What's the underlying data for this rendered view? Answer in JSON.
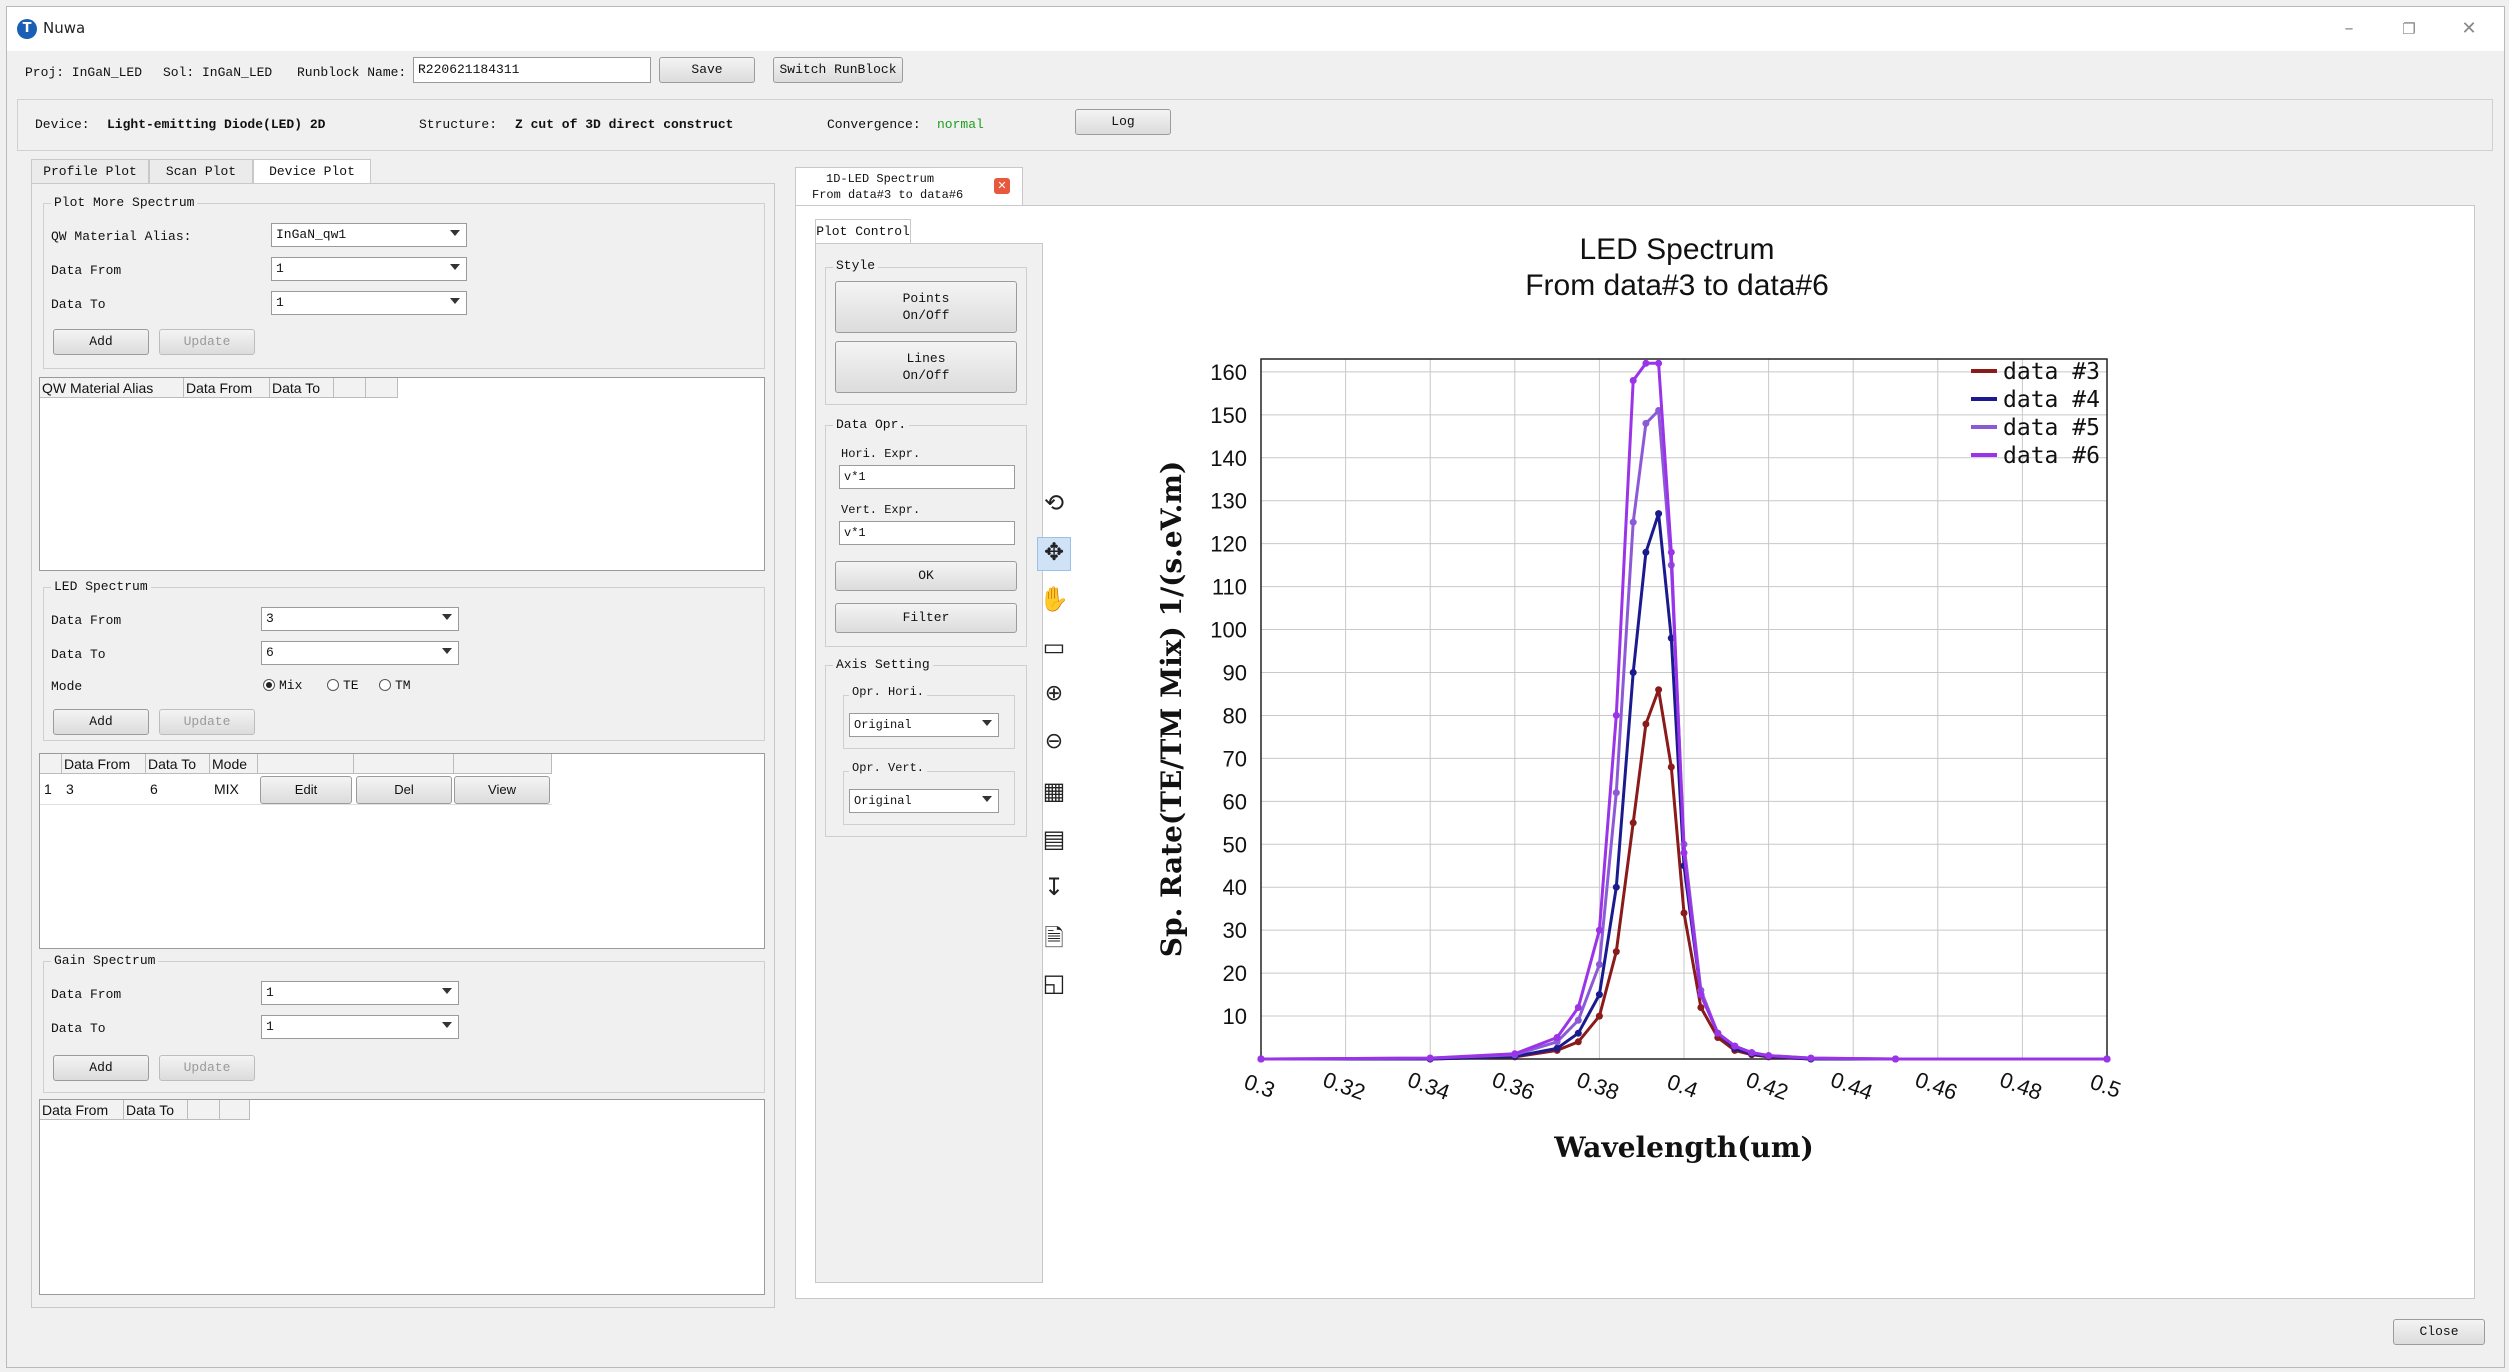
{
  "app": {
    "title": "Nuwa"
  },
  "toolbar": {
    "proj": "Proj: InGaN_LED",
    "sol": "Sol: InGaN_LED",
    "runblock_label": "Runblock Name:",
    "runblock_value": "R220621184311",
    "save_label": "Save",
    "switch_label": "Switch RunBlock"
  },
  "device_bar": {
    "device_label": "Device:",
    "device_value": "Light-emitting Diode(LED) 2D",
    "structure_label": "Structure:",
    "structure_value": "Z cut of 3D direct construct",
    "convergence_label": "Convergence:",
    "convergence_value": "normal",
    "log_label": "Log"
  },
  "colors": {
    "convergence": "#1f9e1f",
    "accent": "#cfe2f6",
    "close_tab": "#e8583c"
  },
  "left_tabs": [
    "Profile Plot",
    "Scan Plot",
    "Device Plot"
  ],
  "more_spectrum": {
    "title": "Plot More Spectrum",
    "alias_label": "QW Material Alias:",
    "alias_value": "InGaN_qw1",
    "from_label": "Data From",
    "from_value": "1",
    "to_label": "Data To",
    "to_value": "1",
    "add": "Add",
    "update": "Update",
    "columns": [
      "QW Material Alias",
      "Data From",
      "Data To",
      "",
      ""
    ]
  },
  "led_spectrum": {
    "title": "LED Spectrum",
    "from_label": "Data From",
    "from_value": "3",
    "to_label": "Data To",
    "to_value": "6",
    "mode_label": "Mode",
    "modes": [
      "Mix",
      "TE",
      "TM"
    ],
    "add": "Add",
    "update": "Update",
    "columns": [
      "Data From",
      "Data To",
      "Mode",
      "",
      "",
      ""
    ],
    "row": {
      "index": "1",
      "from": "3",
      "to": "6",
      "mode": "MIX",
      "edit": "Edit",
      "del": "Del",
      "view": "View"
    }
  },
  "gain_spectrum": {
    "title": "Gain Spectrum",
    "from_label": "Data From",
    "from_value": "1",
    "to_label": "Data To",
    "to_value": "1",
    "add": "Add",
    "update": "Update",
    "columns": [
      "Data From",
      "Data To",
      "",
      ""
    ]
  },
  "plot_tab": {
    "line1": "1D-LED Spectrum",
    "line2": "From data#3 to data#6"
  },
  "plot_control": {
    "tab": "Plot Control",
    "style_title": "Style",
    "points_l1": "Points",
    "points_l2": "On/Off",
    "lines_l1": "Lines",
    "lines_l2": "On/Off",
    "data_opr_title": "Data Opr.",
    "hori_label": "Hori. Expr.",
    "hori_value": "v*1",
    "vert_label": "Vert. Expr.",
    "vert_value": "v*1",
    "ok": "OK",
    "filter": "Filter",
    "axis_title": "Axis Setting",
    "opr_hori_label": "Opr. Hori.",
    "opr_hori_value": "Original",
    "opr_vert_label": "Opr. Vert.",
    "opr_vert_value": "Original"
  },
  "tools": [
    "reset-icon",
    "move-icon",
    "pan-hand-icon",
    "rectangle-select-icon",
    "zoom-in-icon",
    "zoom-out-icon",
    "grid-icon",
    "table-icon",
    "export-icon",
    "document-icon",
    "image-icon"
  ],
  "close_label": "Close",
  "chart_data": {
    "type": "line",
    "title": "LED Spectrum",
    "subtitle": "From data#3 to data#6",
    "xlabel": "Wavelength(um)",
    "ylabel": "Sp. Rate(TE/TM Mix) 1/(s.eV.m)",
    "xlim": [
      0.3,
      0.5
    ],
    "ylim": [
      0,
      163
    ],
    "xticks": [
      "0.3",
      "0.32",
      "0.34",
      "0.36",
      "0.38",
      "0.4",
      "0.42",
      "0.44",
      "0.46",
      "0.48",
      "0.5"
    ],
    "yticks": [
      "10",
      "20",
      "30",
      "40",
      "50",
      "60",
      "70",
      "80",
      "90",
      "100",
      "110",
      "120",
      "130",
      "140",
      "150",
      "160"
    ],
    "grid": true,
    "legend": "top-right",
    "x": [
      0.3,
      0.34,
      0.36,
      0.37,
      0.375,
      0.38,
      0.384,
      0.388,
      0.391,
      0.394,
      0.397,
      0.4,
      0.404,
      0.408,
      0.412,
      0.416,
      0.42,
      0.43,
      0.45,
      0.5
    ],
    "series": [
      {
        "name": "data #3",
        "color": "#8b1a1a",
        "values": [
          0,
          0,
          0.5,
          2,
          4,
          10,
          25,
          55,
          78,
          86,
          68,
          34,
          12,
          5,
          2,
          1,
          0.5,
          0,
          0,
          0
        ]
      },
      {
        "name": "data #4",
        "color": "#1b1b8f",
        "values": [
          0,
          0,
          0.6,
          2.5,
          6,
          15,
          40,
          90,
          118,
          127,
          98,
          45,
          15,
          6,
          2.5,
          1.2,
          0.6,
          0,
          0,
          0
        ]
      },
      {
        "name": "data #5",
        "color": "#8c5ad6",
        "values": [
          0,
          0.2,
          1,
          4,
          9,
          22,
          62,
          125,
          148,
          151,
          115,
          50,
          16,
          6,
          3,
          1.5,
          0.8,
          0.2,
          0,
          0
        ]
      },
      {
        "name": "data #6",
        "color": "#9b34e8",
        "values": [
          0,
          0.2,
          1.2,
          5,
          12,
          30,
          80,
          158,
          162,
          162,
          118,
          48,
          15,
          6,
          3,
          1.5,
          0.8,
          0.2,
          0,
          0
        ]
      }
    ]
  }
}
